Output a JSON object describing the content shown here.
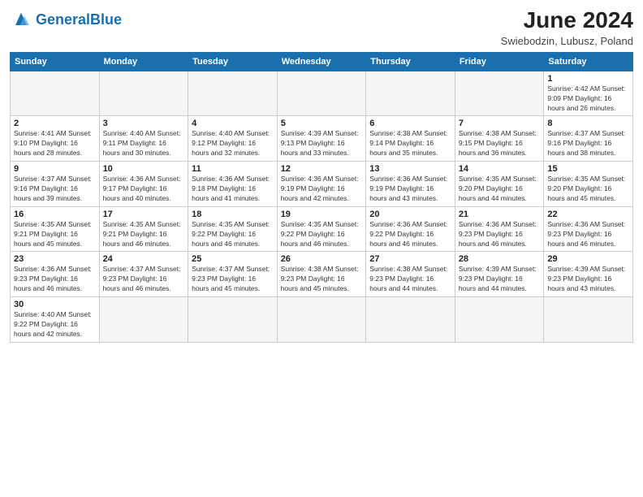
{
  "header": {
    "logo_general": "General",
    "logo_blue": "Blue",
    "month_year": "June 2024",
    "location": "Swiebodzin, Lubusz, Poland"
  },
  "weekdays": [
    "Sunday",
    "Monday",
    "Tuesday",
    "Wednesday",
    "Thursday",
    "Friday",
    "Saturday"
  ],
  "weeks": [
    [
      {
        "day": "",
        "info": "",
        "empty": true
      },
      {
        "day": "",
        "info": "",
        "empty": true
      },
      {
        "day": "",
        "info": "",
        "empty": true
      },
      {
        "day": "",
        "info": "",
        "empty": true
      },
      {
        "day": "",
        "info": "",
        "empty": true
      },
      {
        "day": "",
        "info": "",
        "empty": true
      },
      {
        "day": "1",
        "info": "Sunrise: 4:42 AM\nSunset: 9:09 PM\nDaylight: 16 hours\nand 26 minutes.",
        "empty": false
      }
    ],
    [
      {
        "day": "2",
        "info": "Sunrise: 4:41 AM\nSunset: 9:10 PM\nDaylight: 16 hours\nand 28 minutes.",
        "empty": false
      },
      {
        "day": "3",
        "info": "Sunrise: 4:40 AM\nSunset: 9:11 PM\nDaylight: 16 hours\nand 30 minutes.",
        "empty": false
      },
      {
        "day": "4",
        "info": "Sunrise: 4:40 AM\nSunset: 9:12 PM\nDaylight: 16 hours\nand 32 minutes.",
        "empty": false
      },
      {
        "day": "5",
        "info": "Sunrise: 4:39 AM\nSunset: 9:13 PM\nDaylight: 16 hours\nand 33 minutes.",
        "empty": false
      },
      {
        "day": "6",
        "info": "Sunrise: 4:38 AM\nSunset: 9:14 PM\nDaylight: 16 hours\nand 35 minutes.",
        "empty": false
      },
      {
        "day": "7",
        "info": "Sunrise: 4:38 AM\nSunset: 9:15 PM\nDaylight: 16 hours\nand 36 minutes.",
        "empty": false
      },
      {
        "day": "8",
        "info": "Sunrise: 4:37 AM\nSunset: 9:16 PM\nDaylight: 16 hours\nand 38 minutes.",
        "empty": false
      }
    ],
    [
      {
        "day": "9",
        "info": "Sunrise: 4:37 AM\nSunset: 9:16 PM\nDaylight: 16 hours\nand 39 minutes.",
        "empty": false
      },
      {
        "day": "10",
        "info": "Sunrise: 4:36 AM\nSunset: 9:17 PM\nDaylight: 16 hours\nand 40 minutes.",
        "empty": false
      },
      {
        "day": "11",
        "info": "Sunrise: 4:36 AM\nSunset: 9:18 PM\nDaylight: 16 hours\nand 41 minutes.",
        "empty": false
      },
      {
        "day": "12",
        "info": "Sunrise: 4:36 AM\nSunset: 9:19 PM\nDaylight: 16 hours\nand 42 minutes.",
        "empty": false
      },
      {
        "day": "13",
        "info": "Sunrise: 4:36 AM\nSunset: 9:19 PM\nDaylight: 16 hours\nand 43 minutes.",
        "empty": false
      },
      {
        "day": "14",
        "info": "Sunrise: 4:35 AM\nSunset: 9:20 PM\nDaylight: 16 hours\nand 44 minutes.",
        "empty": false
      },
      {
        "day": "15",
        "info": "Sunrise: 4:35 AM\nSunset: 9:20 PM\nDaylight: 16 hours\nand 45 minutes.",
        "empty": false
      }
    ],
    [
      {
        "day": "16",
        "info": "Sunrise: 4:35 AM\nSunset: 9:21 PM\nDaylight: 16 hours\nand 45 minutes.",
        "empty": false
      },
      {
        "day": "17",
        "info": "Sunrise: 4:35 AM\nSunset: 9:21 PM\nDaylight: 16 hours\nand 46 minutes.",
        "empty": false
      },
      {
        "day": "18",
        "info": "Sunrise: 4:35 AM\nSunset: 9:22 PM\nDaylight: 16 hours\nand 46 minutes.",
        "empty": false
      },
      {
        "day": "19",
        "info": "Sunrise: 4:35 AM\nSunset: 9:22 PM\nDaylight: 16 hours\nand 46 minutes.",
        "empty": false
      },
      {
        "day": "20",
        "info": "Sunrise: 4:36 AM\nSunset: 9:22 PM\nDaylight: 16 hours\nand 46 minutes.",
        "empty": false
      },
      {
        "day": "21",
        "info": "Sunrise: 4:36 AM\nSunset: 9:23 PM\nDaylight: 16 hours\nand 46 minutes.",
        "empty": false
      },
      {
        "day": "22",
        "info": "Sunrise: 4:36 AM\nSunset: 9:23 PM\nDaylight: 16 hours\nand 46 minutes.",
        "empty": false
      }
    ],
    [
      {
        "day": "23",
        "info": "Sunrise: 4:36 AM\nSunset: 9:23 PM\nDaylight: 16 hours\nand 46 minutes.",
        "empty": false
      },
      {
        "day": "24",
        "info": "Sunrise: 4:37 AM\nSunset: 9:23 PM\nDaylight: 16 hours\nand 46 minutes.",
        "empty": false
      },
      {
        "day": "25",
        "info": "Sunrise: 4:37 AM\nSunset: 9:23 PM\nDaylight: 16 hours\nand 45 minutes.",
        "empty": false
      },
      {
        "day": "26",
        "info": "Sunrise: 4:38 AM\nSunset: 9:23 PM\nDaylight: 16 hours\nand 45 minutes.",
        "empty": false
      },
      {
        "day": "27",
        "info": "Sunrise: 4:38 AM\nSunset: 9:23 PM\nDaylight: 16 hours\nand 44 minutes.",
        "empty": false
      },
      {
        "day": "28",
        "info": "Sunrise: 4:39 AM\nSunset: 9:23 PM\nDaylight: 16 hours\nand 44 minutes.",
        "empty": false
      },
      {
        "day": "29",
        "info": "Sunrise: 4:39 AM\nSunset: 9:23 PM\nDaylight: 16 hours\nand 43 minutes.",
        "empty": false
      }
    ],
    [
      {
        "day": "30",
        "info": "Sunrise: 4:40 AM\nSunset: 9:22 PM\nDaylight: 16 hours\nand 42 minutes.",
        "empty": false
      },
      {
        "day": "",
        "info": "",
        "empty": true
      },
      {
        "day": "",
        "info": "",
        "empty": true
      },
      {
        "day": "",
        "info": "",
        "empty": true
      },
      {
        "day": "",
        "info": "",
        "empty": true
      },
      {
        "day": "",
        "info": "",
        "empty": true
      },
      {
        "day": "",
        "info": "",
        "empty": true
      }
    ]
  ]
}
